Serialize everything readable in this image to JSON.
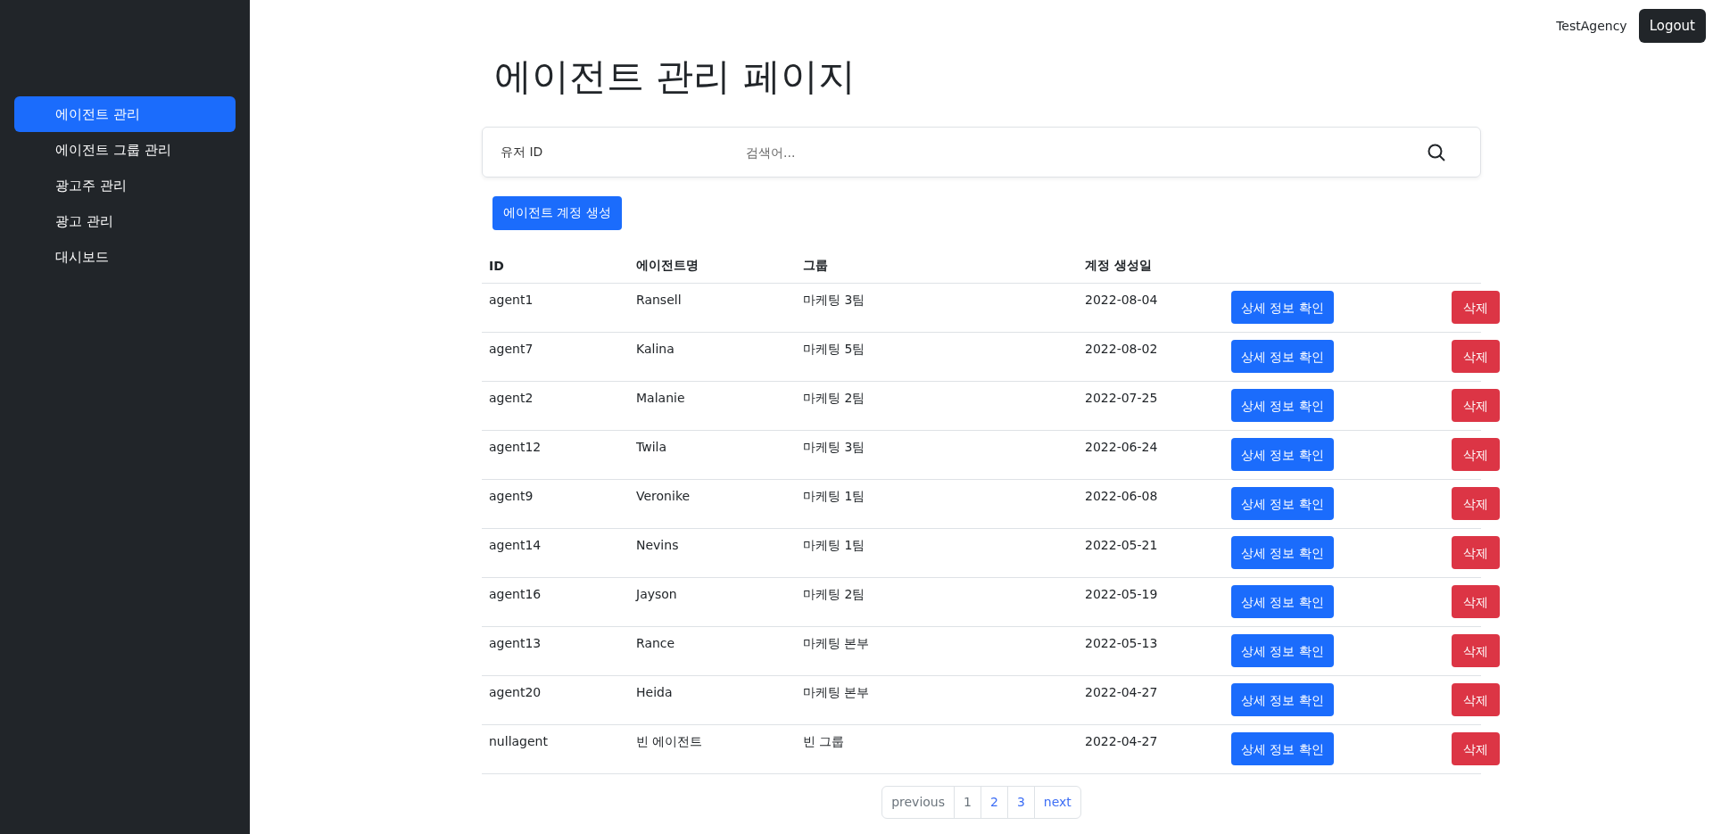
{
  "sidebar": {
    "items": [
      {
        "label": "에이전트 관리",
        "selected": true
      },
      {
        "label": "에이전트 그룹 관리",
        "selected": false
      },
      {
        "label": "광고주 관리",
        "selected": false
      },
      {
        "label": "광고 관리",
        "selected": false
      },
      {
        "label": "대시보드",
        "selected": false
      }
    ]
  },
  "header": {
    "user": "TestAgency",
    "logout": "Logout"
  },
  "title": "에이전트 관리 페이지",
  "search": {
    "field": "유저 ID",
    "placeholder": "검색어..."
  },
  "create_button": "에이전트 계정 생성",
  "table": {
    "columns": [
      "ID",
      "에이전트명",
      "그룹",
      "계정 생성일"
    ],
    "rows": [
      {
        "id": "agent1",
        "name": "Ransell",
        "group": "마케팅 3팀",
        "created": "2022-08-04",
        "detail": "상세 정보 확인",
        "delete": "삭제"
      },
      {
        "id": "agent7",
        "name": "Kalina",
        "group": "마케팅 5팀",
        "created": "2022-08-02",
        "detail": "상세 정보 확인",
        "delete": "삭제"
      },
      {
        "id": "agent2",
        "name": "Malanie",
        "group": "마케팅 2팀",
        "created": "2022-07-25",
        "detail": "상세 정보 확인",
        "delete": "삭제"
      },
      {
        "id": "agent12",
        "name": "Twila",
        "group": "마케팅 3팀",
        "created": "2022-06-24",
        "detail": "상세 정보 확인",
        "delete": "삭제"
      },
      {
        "id": "agent9",
        "name": "Veronike",
        "group": "마케팅 1팀",
        "created": "2022-06-08",
        "detail": "상세 정보 확인",
        "delete": "삭제"
      },
      {
        "id": "agent14",
        "name": "Nevins",
        "group": "마케팅 1팀",
        "created": "2022-05-21",
        "detail": "상세 정보 확인",
        "delete": "삭제"
      },
      {
        "id": "agent16",
        "name": "Jayson",
        "group": "마케팅 2팀",
        "created": "2022-05-19",
        "detail": "상세 정보 확인",
        "delete": "삭제"
      },
      {
        "id": "agent13",
        "name": "Rance",
        "group": "마케팅 본부",
        "created": "2022-05-13",
        "detail": "상세 정보 확인",
        "delete": "삭제"
      },
      {
        "id": "agent20",
        "name": "Heida",
        "group": "마케팅 본부",
        "created": "2022-04-27",
        "detail": "상세 정보 확인",
        "delete": "삭제"
      },
      {
        "id": "nullagent",
        "name": "빈 에이전트",
        "group": "빈 그룹",
        "created": "2022-04-27",
        "detail": "상세 정보 확인",
        "delete": "삭제"
      }
    ]
  },
  "pagination": {
    "previous": {
      "label": "previous",
      "disabled": true
    },
    "pages": [
      {
        "label": "1",
        "selected": true
      },
      {
        "label": "2",
        "selected": false
      },
      {
        "label": "3",
        "selected": false
      }
    ],
    "next": {
      "label": "next",
      "disabled": false
    }
  }
}
